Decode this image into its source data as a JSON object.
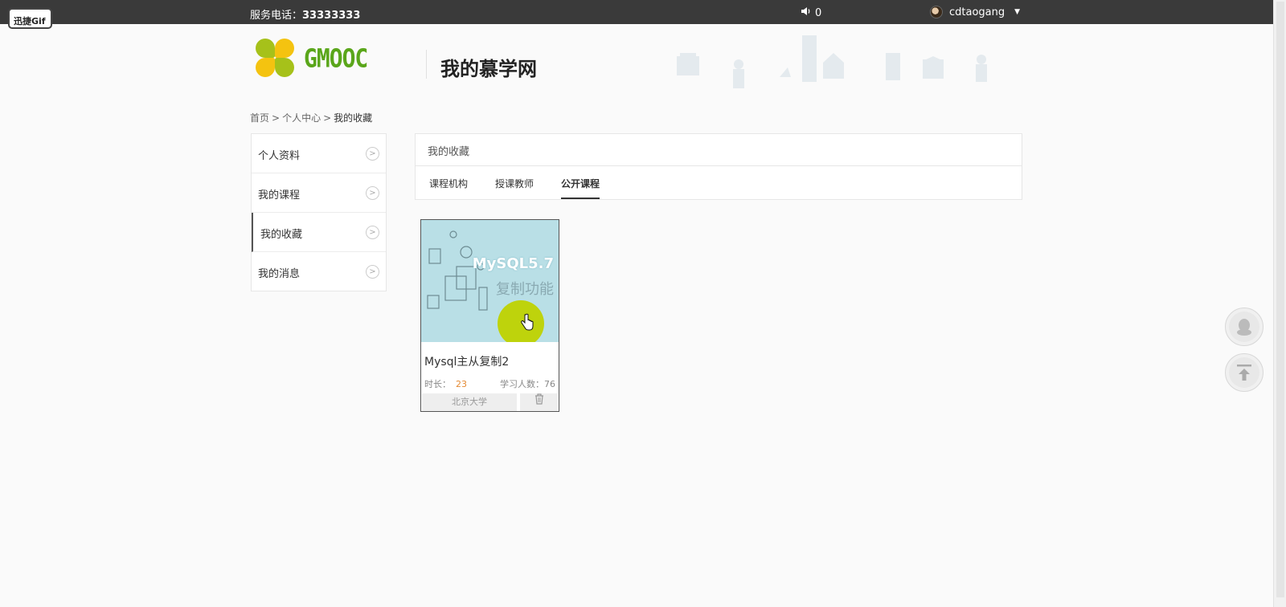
{
  "overlay": {
    "gif_badge": "迅捷Gif"
  },
  "topbar": {
    "service_label": "服务电话：",
    "service_number": "33333333",
    "message_count": "0",
    "username": "cdtaogang"
  },
  "header": {
    "logo_text": "GMOOC",
    "title": "我的慕学网"
  },
  "breadcrumb": {
    "items": [
      "首页",
      "个人中心",
      "我的收藏"
    ],
    "separator": ">"
  },
  "sidebar": {
    "items": [
      {
        "label": "个人资料",
        "active": false
      },
      {
        "label": "我的课程",
        "active": false
      },
      {
        "label": "我的收藏",
        "active": true
      },
      {
        "label": "我的消息",
        "active": false
      }
    ]
  },
  "panel": {
    "heading": "我的收藏",
    "tabs": [
      {
        "label": "课程机构",
        "active": false
      },
      {
        "label": "授课教师",
        "active": false
      },
      {
        "label": "公开课程",
        "active": true
      }
    ]
  },
  "courses": [
    {
      "image_title": "MySQL5.7",
      "image_subtitle": "复制功能",
      "title": "Mysql主从复制2",
      "duration_label": "时长：",
      "duration": "23",
      "students_label": "学习人数：",
      "students": "76",
      "org": "北京大学"
    }
  ],
  "icons": {
    "speaker": "speaker-icon",
    "avatar": "avatar",
    "caret": "caret-down-icon",
    "chevron": "chevron-right-icon",
    "trash": "trash-icon",
    "qq": "qq-icon",
    "back_to_top": "back-to-top-icon",
    "cursor": "hand-cursor-icon"
  },
  "colors": {
    "topbar_bg": "#3a3a3a",
    "logo_green": "#5aa61a",
    "logo_yellow": "#f4c310",
    "duration_orange": "#e48a34"
  }
}
